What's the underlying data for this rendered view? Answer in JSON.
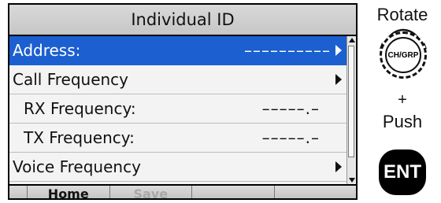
{
  "screen": {
    "title": "Individual ID",
    "items": [
      {
        "label": "Address:",
        "value": "––––––––––",
        "has_arrow": true,
        "selected": true
      },
      {
        "label": "Call Frequency",
        "value": "",
        "has_arrow": true,
        "selected": false
      },
      {
        "label": "RX Frequency:",
        "value": "–––––.–",
        "has_arrow": false,
        "selected": false
      },
      {
        "label": "TX Frequency:",
        "value": "–––––.–",
        "has_arrow": false,
        "selected": false
      },
      {
        "label": "Voice Frequency",
        "value": "",
        "has_arrow": true,
        "selected": false
      }
    ],
    "softkeys": [
      "",
      "Home",
      "Save",
      "",
      ""
    ]
  },
  "hint": {
    "rotate": "Rotate",
    "knob_label": "CH/GRP",
    "plus": "+",
    "push": "Push",
    "ent_label": "ENT"
  },
  "colors": {
    "selected": "#1b5fd0"
  }
}
